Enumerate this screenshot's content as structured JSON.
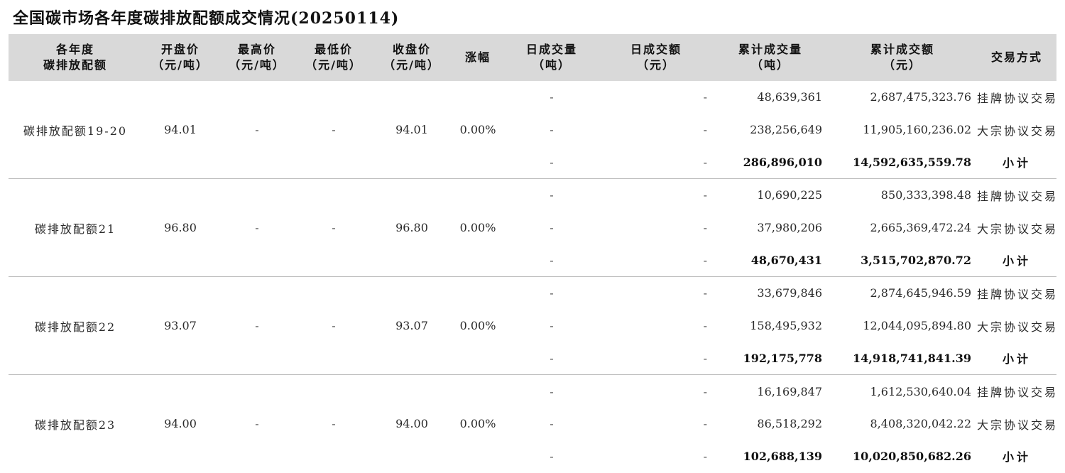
{
  "title": "全国碳市场各年度碳排放配额成交情况(20250114)",
  "headers": {
    "product": [
      "各年度",
      "碳排放配额"
    ],
    "open": [
      "开盘价",
      "（元/吨）"
    ],
    "high": [
      "最高价",
      "（元/吨）"
    ],
    "low": [
      "最低价",
      "（元/吨）"
    ],
    "close": [
      "收盘价",
      "（元/吨）"
    ],
    "change": [
      "涨幅"
    ],
    "daily_volume": [
      "日成交量",
      "（吨）"
    ],
    "daily_amount": [
      "日成交额",
      "（元）"
    ],
    "cum_volume": [
      "累计成交量",
      "（吨）"
    ],
    "cum_amount": [
      "累计成交额",
      "（元）"
    ],
    "method": [
      "交易方式"
    ]
  },
  "groups": [
    {
      "name": "碳排放配额19-20",
      "open": "94.01",
      "high": "-",
      "low": "-",
      "close": "94.01",
      "change": "0.00%",
      "rows": [
        {
          "daily_volume": "-",
          "daily_amount": "-",
          "cum_volume": "48,639,361",
          "cum_amount": "2,687,475,323.76",
          "method": "挂牌协议交易"
        },
        {
          "daily_volume": "-",
          "daily_amount": "-",
          "cum_volume": "238,256,649",
          "cum_amount": "11,905,160,236.02",
          "method": "大宗协议交易"
        },
        {
          "daily_volume": "-",
          "daily_amount": "-",
          "cum_volume": "286,896,010",
          "cum_amount": "14,592,635,559.78",
          "method": "小计"
        }
      ]
    },
    {
      "name": "碳排放配额21",
      "open": "96.80",
      "high": "-",
      "low": "-",
      "close": "96.80",
      "change": "0.00%",
      "rows": [
        {
          "daily_volume": "-",
          "daily_amount": "-",
          "cum_volume": "10,690,225",
          "cum_amount": "850,333,398.48",
          "method": "挂牌协议交易"
        },
        {
          "daily_volume": "-",
          "daily_amount": "-",
          "cum_volume": "37,980,206",
          "cum_amount": "2,665,369,472.24",
          "method": "大宗协议交易"
        },
        {
          "daily_volume": "-",
          "daily_amount": "-",
          "cum_volume": "48,670,431",
          "cum_amount": "3,515,702,870.72",
          "method": "小计"
        }
      ]
    },
    {
      "name": "碳排放配额22",
      "open": "93.07",
      "high": "-",
      "low": "-",
      "close": "93.07",
      "change": "0.00%",
      "rows": [
        {
          "daily_volume": "-",
          "daily_amount": "-",
          "cum_volume": "33,679,846",
          "cum_amount": "2,874,645,946.59",
          "method": "挂牌协议交易"
        },
        {
          "daily_volume": "-",
          "daily_amount": "-",
          "cum_volume": "158,495,932",
          "cum_amount": "12,044,095,894.80",
          "method": "大宗协议交易"
        },
        {
          "daily_volume": "-",
          "daily_amount": "-",
          "cum_volume": "192,175,778",
          "cum_amount": "14,918,741,841.39",
          "method": "小计"
        }
      ]
    },
    {
      "name": "碳排放配额23",
      "open": "94.00",
      "high": "-",
      "low": "-",
      "close": "94.00",
      "change": "0.00%",
      "rows": [
        {
          "daily_volume": "-",
          "daily_amount": "-",
          "cum_volume": "16,169,847",
          "cum_amount": "1,612,530,640.04",
          "method": "挂牌协议交易"
        },
        {
          "daily_volume": "-",
          "daily_amount": "-",
          "cum_volume": "86,518,292",
          "cum_amount": "8,408,320,042.22",
          "method": "大宗协议交易"
        },
        {
          "daily_volume": "-",
          "daily_amount": "-",
          "cum_volume": "102,688,139",
          "cum_amount": "10,020,850,682.26",
          "method": "小计"
        }
      ]
    }
  ]
}
